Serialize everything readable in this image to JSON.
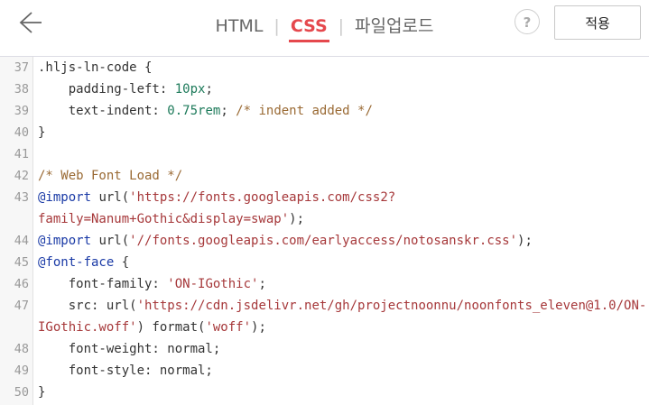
{
  "header": {
    "tabs": [
      {
        "label": "HTML",
        "active": false
      },
      {
        "label": "CSS",
        "active": true
      },
      {
        "label": "파일업로드",
        "active": false
      }
    ],
    "help_label": "?",
    "apply_label": "적용"
  },
  "editor": {
    "lines": [
      {
        "n": "37",
        "text": ".hljs-ln-code {",
        "cont": false
      },
      {
        "n": "38",
        "text": "    padding-left: 10px;",
        "cont": false
      },
      {
        "n": "39",
        "text": "    text-indent: 0.75rem; /* indent added */",
        "cont": false
      },
      {
        "n": "40",
        "text": "}",
        "cont": false
      },
      {
        "n": "41",
        "text": "",
        "cont": false
      },
      {
        "n": "42",
        "text": "/* Web Font Load */",
        "cont": false
      },
      {
        "n": "43",
        "text": "@import url('https://fonts.googleapis.com/css2?",
        "cont": false
      },
      {
        "n": "",
        "text": "family=Nanum+Gothic&display=swap');",
        "cont": true
      },
      {
        "n": "44",
        "text": "@import url('//fonts.googleapis.com/earlyaccess/notosanskr.css');",
        "cont": false
      },
      {
        "n": "45",
        "text": "@font-face {",
        "cont": false
      },
      {
        "n": "46",
        "text": "    font-family: 'ON-IGothic';",
        "cont": false
      },
      {
        "n": "47",
        "text": "    src: url('https://cdn.jsdelivr.net/gh/projectnoonnu/noonfonts_eleven@1.0/ON-",
        "cont": false
      },
      {
        "n": "",
        "text": "IGothic.woff') format('woff');",
        "cont": true
      },
      {
        "n": "48",
        "text": "    font-weight: normal;",
        "cont": false
      },
      {
        "n": "49",
        "text": "    font-style: normal;",
        "cont": false
      },
      {
        "n": "50",
        "text": "}",
        "cont": false
      }
    ]
  },
  "colors": {
    "accent": "#e5484d",
    "keyword": "#1a3aa6",
    "string": "#a6383a",
    "comment": "#9a6a34",
    "number": "#1d7a5a"
  }
}
